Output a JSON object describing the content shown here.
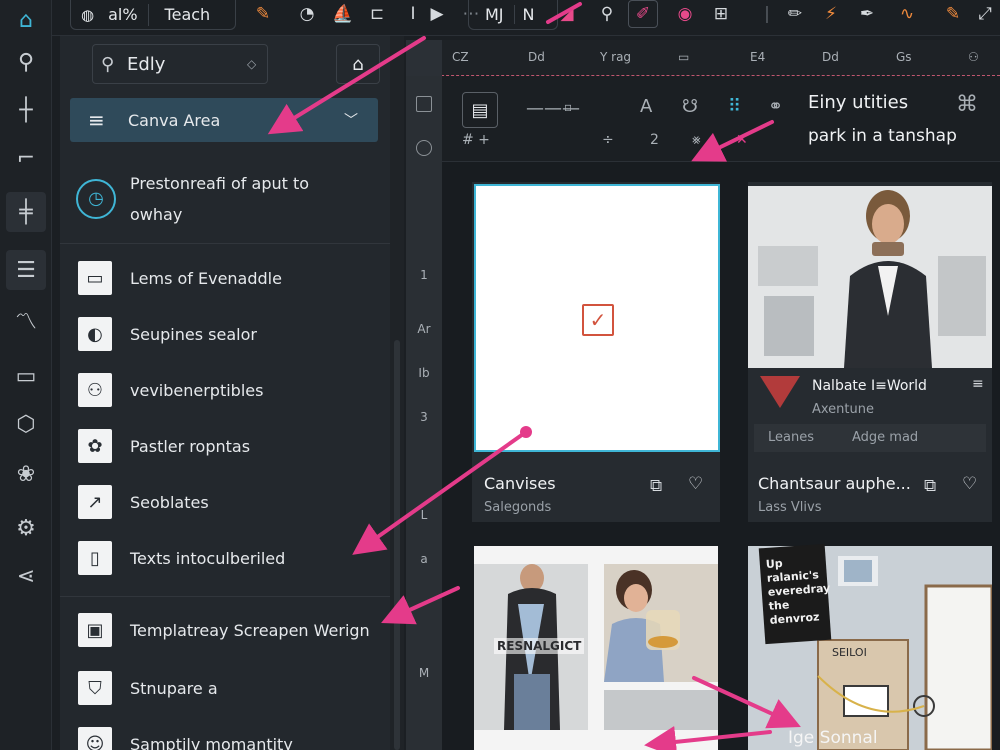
{
  "toolbar": {
    "zoom_label": "al%",
    "teach_label": "Teach",
    "mj_label": "MJ",
    "n_label": "N"
  },
  "panel": {
    "search_value": "Edly",
    "dropdown_label": "Canva Area",
    "presto_label": "Prestonreafi of aput to owhay",
    "items": [
      {
        "label": "Lems of Evenaddle",
        "icon": "▭"
      },
      {
        "label": "Seupines sealor",
        "icon": "◐"
      },
      {
        "label": "vevibenerptibles",
        "icon": "⚇"
      },
      {
        "label": "Pastler ropntas",
        "icon": "✿"
      },
      {
        "label": "Seoblates",
        "icon": "↗"
      },
      {
        "label": "Texts intoculberiled",
        "icon": "▯"
      },
      {
        "label": "Templatreay Screapen Werign",
        "icon": "▣"
      },
      {
        "label": "Stnupare a",
        "icon": "⛉"
      },
      {
        "label": "Samptily momantity",
        "icon": "☺"
      }
    ]
  },
  "ruler": {
    "labels": [
      "CZ",
      "Dd",
      "Y rag",
      "▭",
      "E4",
      "Dd",
      "Gs",
      "⚇"
    ]
  },
  "vruler": {
    "labels": [
      "1",
      "Ar",
      "Ib",
      "3",
      "L",
      "a",
      "M"
    ]
  },
  "subbar": {
    "heading_1": "Einy utities",
    "heading_2": "park in a tanshap",
    "marks": [
      "#  +",
      "÷",
      "2",
      "⨳",
      "✕"
    ]
  },
  "cards": {
    "blank": {
      "title": "Canvises",
      "subtitle": "Salegonds"
    },
    "business": {
      "brand": "Nalbate I≡World",
      "brand_sub": "Axentune",
      "tags": [
        "Leanes",
        "Adge mad"
      ],
      "title": "Chantsaur auphe...",
      "subtitle": "Lass Vlivs"
    },
    "fashion": {
      "overlay": "RESNALGICT"
    },
    "poster": {
      "sticker": "Up ralanic's everedray the denvroz",
      "board_label": "SEILOI",
      "title": "Ige Sonnal"
    }
  },
  "colors": {
    "accent_cyan": "#3fb6d6",
    "accent_pink": "#e43b8a",
    "check_red": "#d2533d",
    "panel_bg": "#23282d",
    "dropdown_bg": "#2f4a5a"
  }
}
